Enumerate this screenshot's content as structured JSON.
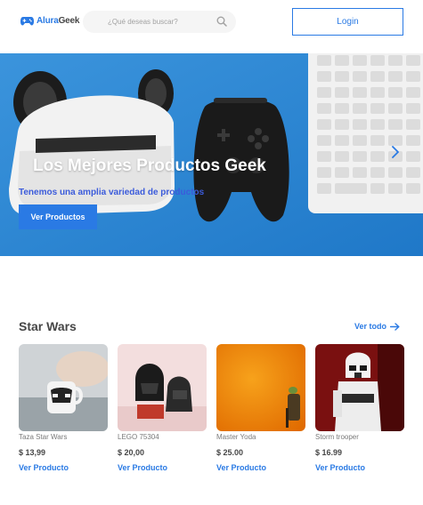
{
  "header": {
    "logo": {
      "part1": "Alura",
      "part2": "Geek"
    },
    "search_placeholder": "¿Qué deseas buscar?",
    "login_label": "Login"
  },
  "hero": {
    "title": "Los Mejores Productos Geek",
    "subtitle": "Tenemos una amplia variedad de productos",
    "button_label": "Ver Productos"
  },
  "section": {
    "title": "Star Wars",
    "see_all_label": "Ver todo"
  },
  "products": [
    {
      "name": "Taza Star Wars",
      "price": "$ 13,99",
      "link": "Ver Producto"
    },
    {
      "name": "LEGO 75304",
      "price": "$ 20,00",
      "link": "Ver Producto"
    },
    {
      "name": "Master Yoda",
      "price": "$ 25.00",
      "link": "Ver Producto"
    },
    {
      "name": "Storm trooper",
      "price": "$ 16.99",
      "link": "Ver Producto"
    }
  ],
  "colors": {
    "accent": "#2a7ae4",
    "text": "#464646",
    "hero_bg": "#2f8ad6"
  },
  "icons": [
    "gamepad-logo-icon",
    "search-icon",
    "chevron-right-icon",
    "arrow-right-icon"
  ]
}
